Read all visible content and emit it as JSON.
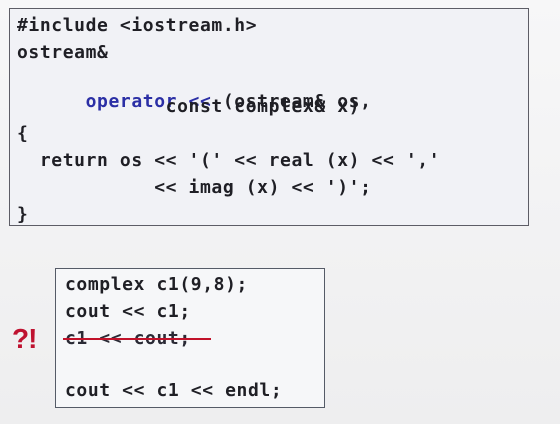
{
  "code_panel": {
    "lines": [
      "#include <iostream.h>",
      "ostream&",
      "operator << (ostream& os,",
      "             const complex& x)",
      "{",
      "  return os << '(' << real (x) << ','",
      "            << imag (x) << ')';",
      "}"
    ],
    "keyword_text": "operator <<",
    "keyword_color": "#2b2fa5"
  },
  "example_panel": {
    "lines": [
      "complex c1(9,8);",
      "cout << c1;",
      "c1 << cout;",
      "cout << c1 << endl;"
    ],
    "highlight_color": "#f5f300",
    "strike_color": "#c1122a"
  },
  "warning_mark": "?!"
}
